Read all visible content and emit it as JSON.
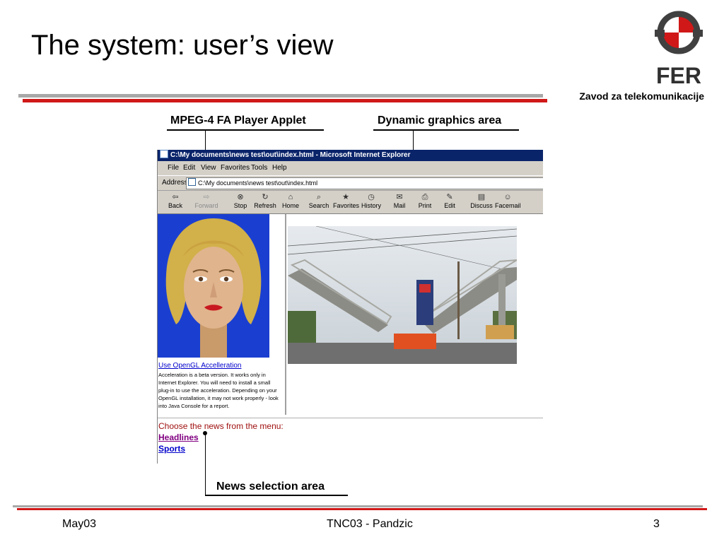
{
  "slide": {
    "title": "The system: user’s view",
    "organization": "Zavod za telekomunikacije",
    "logo_text": "FER"
  },
  "callouts": {
    "player_applet": "MPEG-4 FA Player Applet",
    "graphics_area": "Dynamic graphics area",
    "news_area": "News selection area"
  },
  "browser": {
    "title": "C:\\My documents\\news test\\out\\index.html - Microsoft Internet Explorer",
    "menu": [
      "File",
      "Edit",
      "View",
      "Favorites",
      "Tools",
      "Help"
    ],
    "address_label": "Address",
    "address_value": "C:\\My documents\\news test\\out\\index.html",
    "toolbar": [
      {
        "label": "Back",
        "icon": "back-arrow-icon"
      },
      {
        "label": "Forward",
        "icon": "forward-arrow-icon"
      },
      {
        "label": "Stop",
        "icon": "stop-icon"
      },
      {
        "label": "Refresh",
        "icon": "refresh-icon"
      },
      {
        "label": "Home",
        "icon": "home-icon"
      },
      {
        "label": "Search",
        "icon": "search-icon"
      },
      {
        "label": "Favorites",
        "icon": "favorites-icon"
      },
      {
        "label": "History",
        "icon": "history-icon"
      },
      {
        "label": "Mail",
        "icon": "mail-icon"
      },
      {
        "label": "Print",
        "icon": "print-icon"
      },
      {
        "label": "Edit",
        "icon": "edit-icon"
      },
      {
        "label": "Discuss",
        "icon": "discuss-icon"
      },
      {
        "label": "Facemail",
        "icon": "facemail-icon"
      }
    ]
  },
  "content": {
    "gl_link": "Use OpenGL Accelleration",
    "gl_description": "Acceleration is a beta version. It works only in Internet Explorer. You will need to install a small plug-in to use the acceleration. Depending on your OpenGL installation, it may not work properly - look into Java Console for a report.",
    "news_prompt": "Choose the news from the menu:",
    "news_links": [
      "Headlines",
      "Sports"
    ]
  },
  "footer": {
    "date": "May03",
    "center": "TNC03 - Pandzic",
    "page": "3"
  },
  "colors": {
    "accent_red": "#d01818",
    "bar_gray": "#a8a8a8",
    "titlebar_blue": "#0a246a"
  }
}
